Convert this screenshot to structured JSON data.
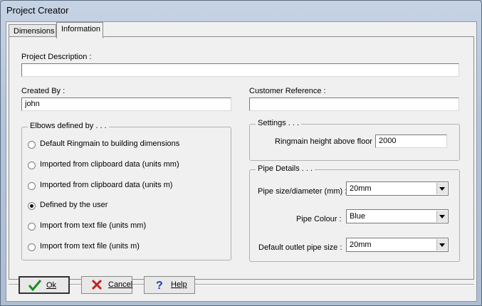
{
  "window": {
    "title": "Project Creator"
  },
  "tabs": [
    {
      "label": "Dimensions"
    },
    {
      "label": "Information"
    }
  ],
  "info": {
    "project_description": {
      "label": "Project Description :",
      "value": ""
    },
    "created_by": {
      "label": "Created By :",
      "value": "john"
    },
    "customer_reference": {
      "label": "Customer Reference :",
      "value": ""
    }
  },
  "elbows": {
    "title": "Elbows defined by . . .",
    "options": [
      {
        "label": "Default Ringmain to building dimensions",
        "selected": false
      },
      {
        "label": "Imported from clipboard data (units mm)",
        "selected": false
      },
      {
        "label": "Imported from clipboard data (units m)",
        "selected": false
      },
      {
        "label": "Defined by the user",
        "selected": true
      },
      {
        "label": "Import from text file (units mm)",
        "selected": false
      },
      {
        "label": "Import from text file (units m)",
        "selected": false
      }
    ]
  },
  "settings": {
    "title": "Settings . . .",
    "ringmain_height_label": "Ringmain height above floor :",
    "ringmain_height_value": "2000"
  },
  "pipe_details": {
    "title": "Pipe Details . . .",
    "size_label": "Pipe size/diameter (mm) :",
    "size_value": "20mm",
    "colour_label": "Pipe Colour :",
    "colour_value": "Blue",
    "outlet_label": "Default outlet pipe size :",
    "outlet_value": "20mm"
  },
  "buttons": {
    "ok": "Ok",
    "cancel": "Cancel",
    "help": "Help"
  },
  "colors": {
    "ok_check": "#1a8c1a",
    "cancel_x": "#c81e1e",
    "help_q": "#1f3fae"
  }
}
